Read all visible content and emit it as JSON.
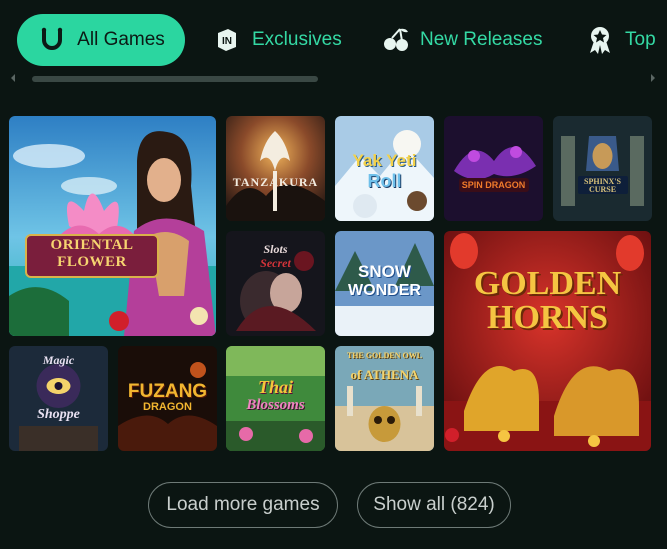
{
  "nav": {
    "tabs": [
      {
        "label": "All Games",
        "icon": "horseshoe-icon"
      },
      {
        "label": "Exclusives",
        "icon": "in-badge-icon"
      },
      {
        "label": "New Releases",
        "icon": "cherries-icon"
      },
      {
        "label": "Top",
        "icon": "award-ribbon-icon"
      }
    ]
  },
  "games": [
    {
      "title_line1": "ORIENTAL",
      "title_line2": "FLOWER"
    },
    {
      "title": "TANZAKURA"
    },
    {
      "title_line1": "Yak Yeti",
      "title_line2": "Roll"
    },
    {
      "title": "SPIN DRAGON"
    },
    {
      "title_line1": "SPHINX'S",
      "title_line2": "CURSE"
    },
    {
      "title_line1": "Slots",
      "title_line2": "Secret"
    },
    {
      "title_line1": "SNOW",
      "title_line2": "WONDER"
    },
    {
      "title_line1": "GOLDEN",
      "title_line2": "HORNS"
    },
    {
      "title_line1": "Magic",
      "title_line2": "Shoppe"
    },
    {
      "title_line1": "FUZANG",
      "title_line2": "DRAGON"
    },
    {
      "title_line1": "Thai",
      "title_line2": "Blossoms"
    },
    {
      "title_line1": "THE GOLDEN OWL",
      "title_line2": "of ATHENA"
    }
  ],
  "actions": {
    "load_more_label": "Load more games",
    "show_all_label": "Show all (824)"
  },
  "colors": {
    "background": "#0b1512",
    "accent": "#2bd6a0",
    "tab_text": "#34d9a4"
  }
}
